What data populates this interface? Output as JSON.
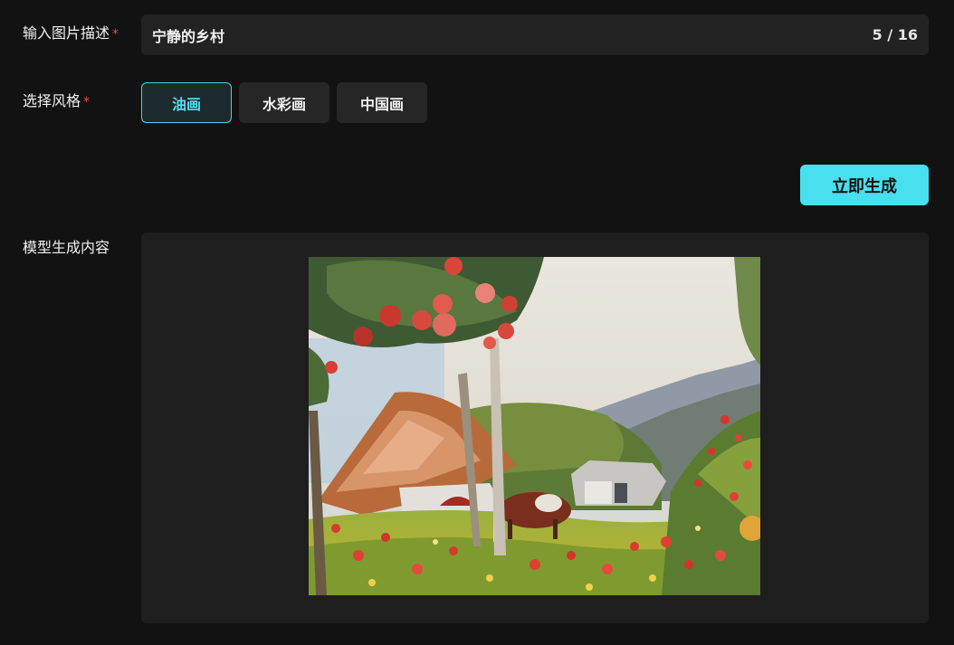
{
  "form": {
    "description": {
      "label": "输入图片描述",
      "required_mark": "*",
      "value": "宁静的乡村",
      "counter": "5 / 16"
    },
    "style": {
      "label": "选择风格",
      "required_mark": "*",
      "options": [
        "油画",
        "水彩画",
        "中国画"
      ],
      "selected": "油画"
    },
    "generate_label": "立即生成"
  },
  "output": {
    "label": "模型生成内容",
    "image_icon": "oil-painting-rural-village"
  },
  "colors": {
    "accent": "#48e0ef",
    "required": "#e5484d",
    "background": "#131213",
    "panel": "#1f1e1f"
  }
}
